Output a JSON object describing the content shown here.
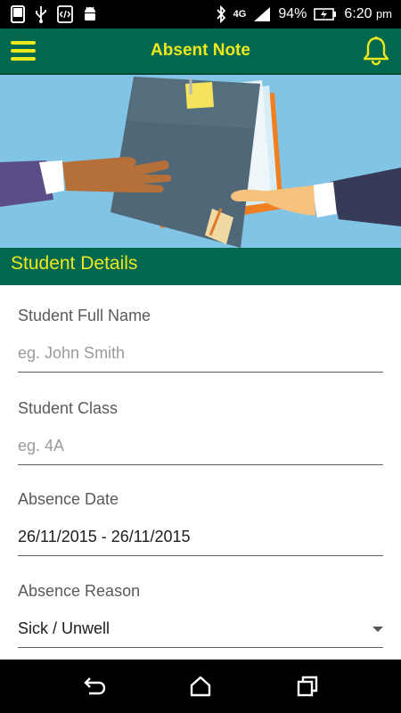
{
  "status_bar": {
    "network": "4G",
    "battery": "94%",
    "time": "6:20",
    "time_suffix": "pm"
  },
  "app_bar": {
    "title": "Absent Note",
    "menu_icon": "hamburger-menu-icon",
    "bell_icon": "bell-icon"
  },
  "section": {
    "title": "Student Details"
  },
  "form": {
    "student_name": {
      "label": "Student Full Name",
      "placeholder": "eg. John Smith"
    },
    "student_class": {
      "label": "Student Class",
      "placeholder": "eg. 4A"
    },
    "absence_date": {
      "label": "Absence Date",
      "value": "26/11/2015 - 26/11/2015"
    },
    "absence_reason": {
      "label": "Absence Reason",
      "value": "Sick / Unwell"
    }
  },
  "colors": {
    "primary": "#00684f",
    "accent": "#f0e81f",
    "hero_background": "#82c4e6"
  }
}
